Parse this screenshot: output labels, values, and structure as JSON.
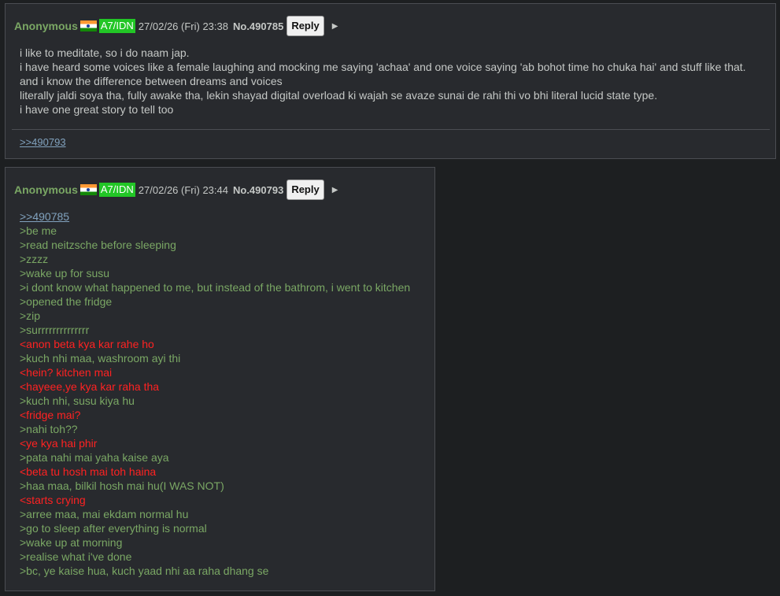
{
  "posts": [
    {
      "name": "Anonymous",
      "flag": "india-flag-icon",
      "id_badge": "A7/IDN",
      "datetime": "27/02/26 (Fri) 23:38",
      "number": "No.490785",
      "reply_label": "Reply",
      "menu_icon": "triangle-right-icon",
      "lines": [
        "i like to meditate, so i do naam jap.",
        "i have heard some voices like a female laughing and mocking me saying 'achaa' and one voice saying 'ab bohot time ho chuka hai' and stuff like that.",
        "and i know the difference between dreams and voices",
        "literally jaldi soya tha, fully awake tha, lekin shayad digital overload ki wajah se avaze sunai de rahi thi vo bhi literal lucid state type.",
        "i have one great story to tell too"
      ],
      "backlink": ">>490793"
    },
    {
      "name": "Anonymous",
      "flag": "india-flag-icon",
      "id_badge": "A7/IDN",
      "datetime": "27/02/26 (Fri) 23:44",
      "number": "No.490793",
      "reply_label": "Reply",
      "menu_icon": "triangle-right-icon",
      "quote_link": ">>490785",
      "lines": [
        {
          "text": ">be me",
          "type": "green"
        },
        {
          "text": ">read neitzsche before sleeping",
          "type": "green"
        },
        {
          "text": ">zzzz",
          "type": "green"
        },
        {
          "text": ">wake up for susu",
          "type": "green"
        },
        {
          "text": ">i dont know what happened to me, but instead of the bathrom, i went to kitchen",
          "type": "green"
        },
        {
          "text": ">opened the fridge",
          "type": "green"
        },
        {
          "text": ">zip",
          "type": "green"
        },
        {
          "text": ">surrrrrrrrrrrrrr",
          "type": "green"
        },
        {
          "text": "<anon beta kya kar rahe ho",
          "type": "red"
        },
        {
          "text": ">kuch nhi maa, washroom ayi thi",
          "type": "green"
        },
        {
          "text": "<hein? kitchen mai",
          "type": "red"
        },
        {
          "text": "<hayeee,ye kya kar raha tha",
          "type": "red"
        },
        {
          "text": ">kuch nhi, susu kiya hu",
          "type": "green"
        },
        {
          "text": "<fridge mai?",
          "type": "red"
        },
        {
          "text": ">nahi toh??",
          "type": "green"
        },
        {
          "text": "<ye kya hai phir",
          "type": "red"
        },
        {
          "text": ">pata nahi mai yaha kaise aya",
          "type": "green"
        },
        {
          "text": "<beta tu hosh mai toh haina",
          "type": "red"
        },
        {
          "text": ">haa maa, bilkil hosh mai hu(I WAS NOT)",
          "type": "green"
        },
        {
          "text": "<starts crying",
          "type": "red"
        },
        {
          "text": ">arree maa, mai ekdam normal hu",
          "type": "green"
        },
        {
          "text": ">go to sleep after everything is normal",
          "type": "green"
        },
        {
          "text": ">wake up at morning",
          "type": "green"
        },
        {
          "text": ">realise what i've done",
          "type": "green"
        },
        {
          "text": ">bc, ye kaise hua, kuch yaad nhi aa raha dhang se",
          "type": "green"
        }
      ]
    }
  ],
  "colors": {
    "background": "#1d1f21",
    "post_background": "#282a2e",
    "name": "#7aa764",
    "greentext": "#7aa764",
    "redtext": "#ff2222",
    "quotelink": "#81a2be",
    "id_badge": "#22c626"
  }
}
